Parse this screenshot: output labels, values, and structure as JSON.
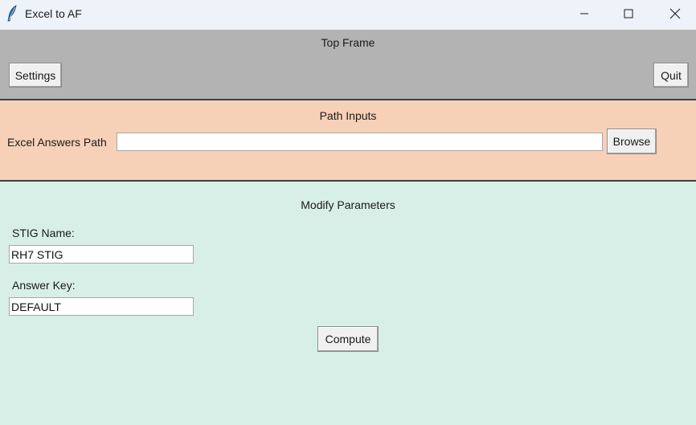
{
  "window": {
    "title": "Excel to AF",
    "icons": {
      "app": "feather-icon",
      "minimize": "minimize-icon",
      "maximize": "maximize-icon",
      "close": "close-icon"
    }
  },
  "top_frame": {
    "title": "Top Frame",
    "settings_label": "Settings",
    "quit_label": "Quit"
  },
  "path_inputs": {
    "title": "Path Inputs",
    "excel_label": "Excel Answers Path",
    "excel_value": "",
    "browse_label": "Browse"
  },
  "parameters": {
    "title": "Modify Parameters",
    "stig_label": "STIG Name:",
    "stig_value": "RH7 STIG",
    "answer_label": "Answer Key:",
    "answer_value": "DEFAULT",
    "compute_label": "Compute"
  },
  "colors": {
    "top_frame_bg": "#b3b3b3",
    "path_frame_bg": "#f6d1b8",
    "param_frame_bg": "#d8efe8"
  }
}
